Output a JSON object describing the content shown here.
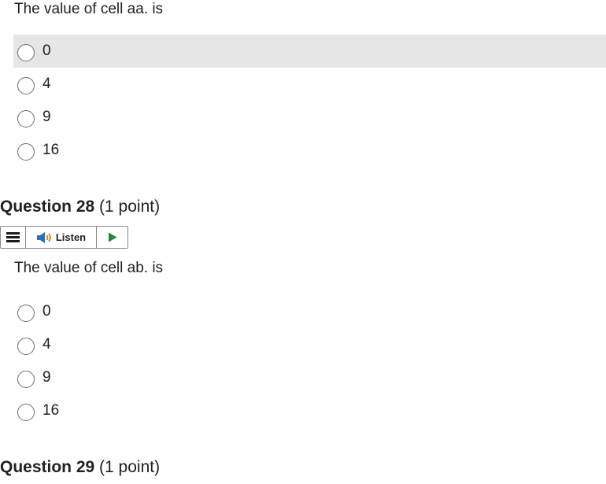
{
  "question27": {
    "prompt": "The value of cell aa. is",
    "options": [
      "0",
      "4",
      "9",
      "16"
    ],
    "hovered_index": 0
  },
  "question28": {
    "number_label": "Question 28",
    "points_label": "(1 point)",
    "listen_label": "Listen",
    "prompt": "The value of cell ab. is",
    "options": [
      "0",
      "4",
      "9",
      "16"
    ]
  },
  "question29": {
    "number_label": "Question 29",
    "points_label": "(1 point)"
  },
  "icons": {
    "menu": "menu-icon",
    "speaker": "speaker-icon",
    "play": "play-icon"
  },
  "colors": {
    "hover_bg": "#e6e6e6",
    "play_green": "#1b8a3c",
    "speaker_orange": "#e07b00",
    "speaker_blue": "#2a6ebb"
  }
}
